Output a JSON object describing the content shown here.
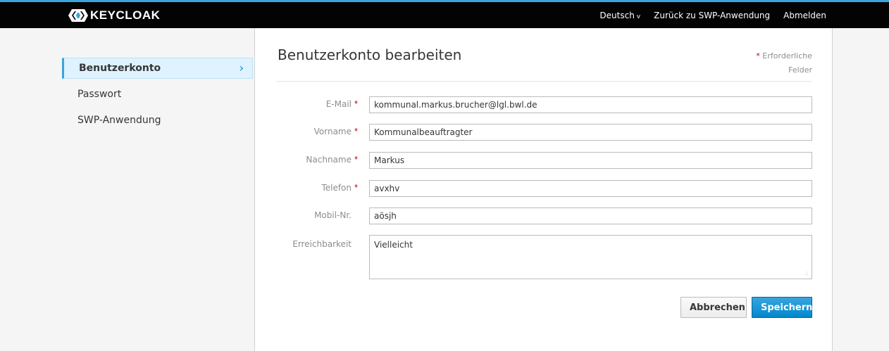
{
  "header": {
    "logo_text": "KEYCLOAK",
    "nav": {
      "language": "Deutsch",
      "back_link": "Zurück zu SWP-Anwendung",
      "logout": "Abmelden"
    }
  },
  "colors": {
    "accent": "#39a5dc",
    "primary_button": "#0088ce",
    "header_bg": "#030303",
    "required": "#cc0000"
  },
  "sidebar": {
    "items": [
      {
        "label": "Benutzerkonto",
        "active": true
      },
      {
        "label": "Passwort",
        "active": false
      },
      {
        "label": "SWP-Anwendung",
        "active": false
      }
    ]
  },
  "main": {
    "title": "Benutzerkonto bearbeiten",
    "required_note": {
      "star": "*",
      "line1": "Erforderliche",
      "line2": "Felder"
    },
    "form": {
      "email": {
        "label": "E-Mail",
        "required": true,
        "value": "kommunal.markus.brucher@lgl.bwl.de"
      },
      "firstname": {
        "label": "Vorname",
        "required": true,
        "value": "Kommunalbeauftragter"
      },
      "lastname": {
        "label": "Nachname",
        "required": true,
        "value": "Markus"
      },
      "phone": {
        "label": "Telefon",
        "required": true,
        "value": "avxhv"
      },
      "mobile": {
        "label": "Mobil-Nr.",
        "required": false,
        "value": "aösjh"
      },
      "availability": {
        "label": "Erreichbarkeit",
        "required": false,
        "value": "Vielleicht"
      }
    },
    "buttons": {
      "cancel": "Abbrechen",
      "save": "Speichern"
    }
  }
}
